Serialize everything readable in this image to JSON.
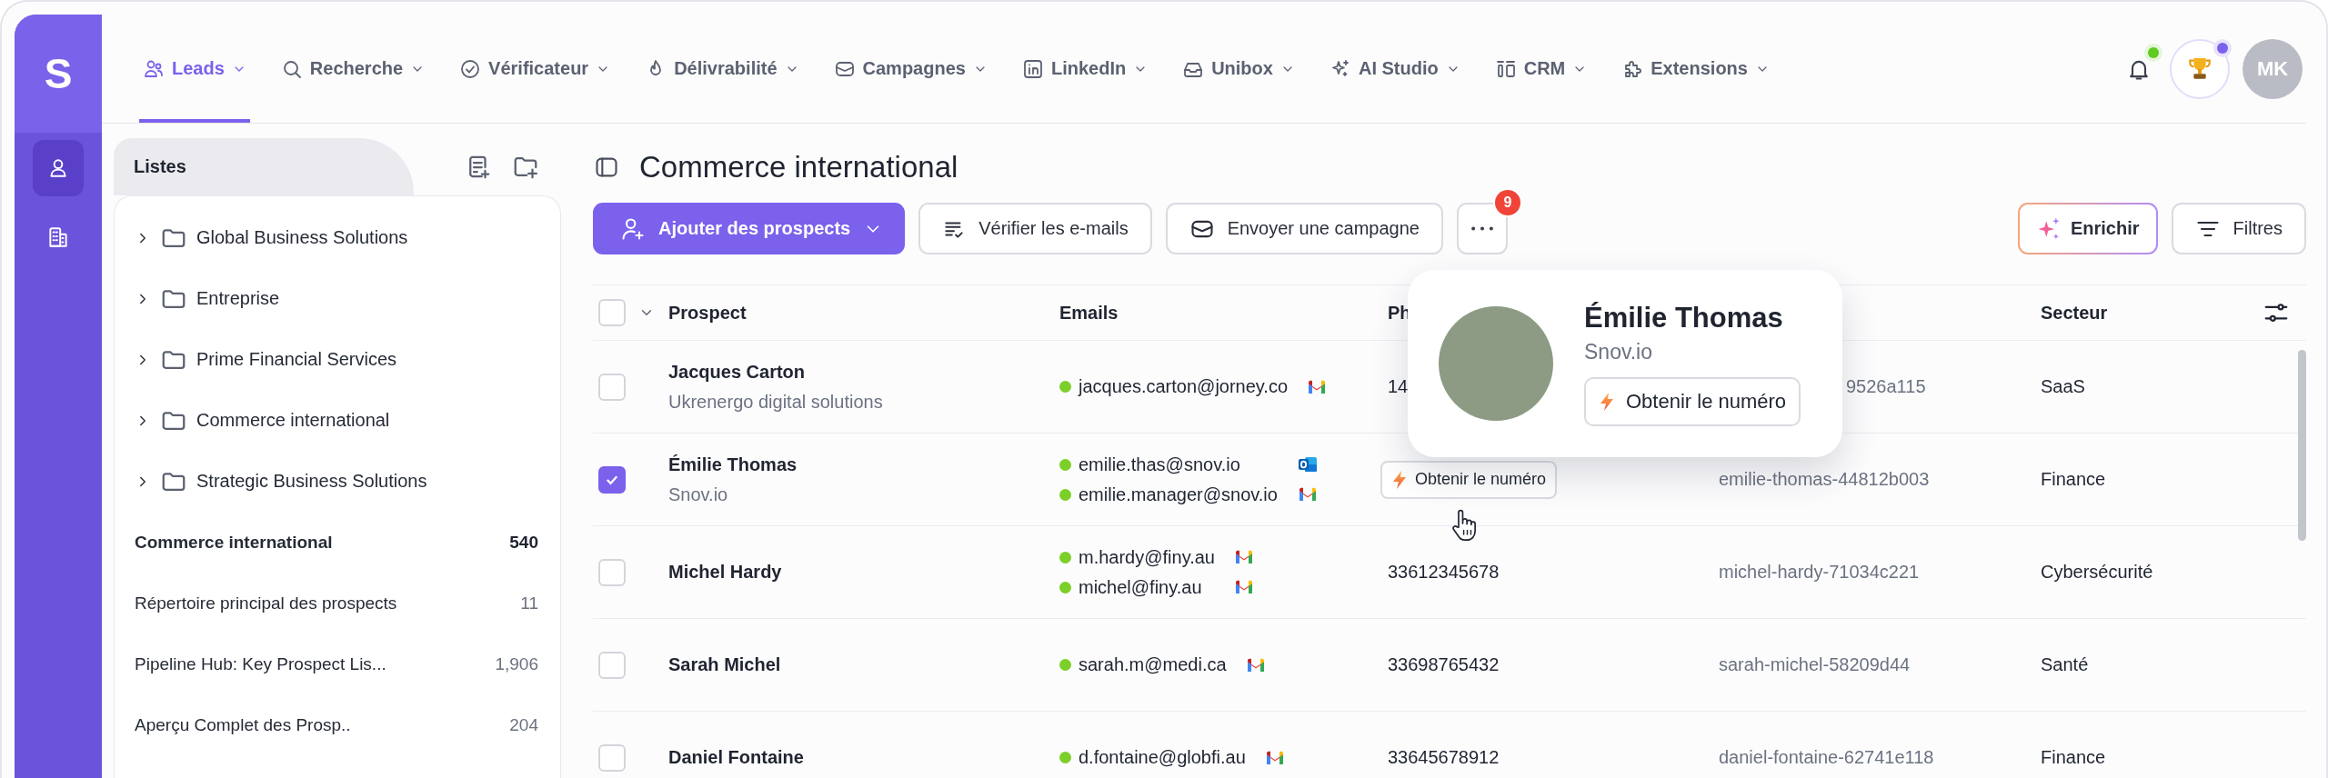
{
  "rail": {
    "logo": "S",
    "items": [
      {
        "selected": true
      },
      {
        "selected": false
      }
    ]
  },
  "nav": {
    "items": [
      {
        "label": "Leads",
        "selected": true
      },
      {
        "label": "Recherche",
        "selected": false
      },
      {
        "label": "Vérificateur",
        "selected": false
      },
      {
        "label": "Délivrabilité",
        "selected": false
      },
      {
        "label": "Campagnes",
        "selected": false
      },
      {
        "label": "LinkedIn",
        "selected": false
      },
      {
        "label": "Unibox",
        "selected": false
      },
      {
        "label": "AI Studio",
        "selected": false
      },
      {
        "label": "CRM",
        "selected": false
      },
      {
        "label": "Extensions",
        "selected": false
      }
    ],
    "notifications": {
      "unread": true
    },
    "rewards": {
      "unread": true
    },
    "avatar": "MK"
  },
  "sidebar": {
    "title": "Listes",
    "folders": [
      {
        "label": "Global Business Solutions",
        "expanded": false
      },
      {
        "label": "Entreprise",
        "expanded": false
      },
      {
        "label": "Prime Financial Services",
        "expanded": false
      },
      {
        "label": "Commerce international",
        "expanded": false
      },
      {
        "label": "Strategic Business Solutions",
        "expanded": false
      }
    ],
    "lists": [
      {
        "label": "Commerce international",
        "count": "540",
        "selected": true
      },
      {
        "label": "Répertoire principal des prospects",
        "count": "11",
        "selected": false
      },
      {
        "label": "Pipeline Hub: Key Prospect Lis...",
        "count": "1,906",
        "selected": false
      },
      {
        "label": "Aperçu Complet des Prosp..",
        "count": "204",
        "selected": false
      }
    ]
  },
  "main": {
    "title": "Commerce international",
    "toolbar": {
      "add": "Ajouter des prospects",
      "verify": "Vérifier les e-mails",
      "campaign": "Envoyer une campagne",
      "more_badge": "9",
      "enrich": "Enrichir",
      "filters": "Filtres"
    },
    "table": {
      "select_all": {
        "checked": false
      },
      "columns": {
        "prospect": "Prospect",
        "emails": "Emails",
        "column_3": "Ph",
        "sector": "Secteur"
      },
      "rows": [
        {
          "name": "Jacques Carton",
          "company": "Ukrenergo digital solutions",
          "selected": false,
          "emails": [
            {
              "address": "jacques.carton@jorney.co",
              "kind": "gmail"
            }
          ],
          "phone": {
            "kind": "text",
            "value": "14"
          },
          "linkedin": "9526a115",
          "sector": "SaaS"
        },
        {
          "name": "Émilie Thomas",
          "company": "Snov.io",
          "selected": true,
          "emails": [
            {
              "address": "emilie.thas@snov.io",
              "kind": "outlook"
            },
            {
              "address": "emilie.manager@snov.io",
              "kind": "gmail"
            }
          ],
          "phone": {
            "kind": "action",
            "label": "Obtenir le numéro",
            "hovered": true
          },
          "linkedin": "emilie-thomas-44812b003",
          "sector": "Finance"
        },
        {
          "name": "Michel Hardy",
          "selected": false,
          "emails": [
            {
              "address": "m.hardy@finy.au",
              "kind": "gmail"
            },
            {
              "address": "michel@finy.au",
              "kind": "gmail"
            }
          ],
          "phone": {
            "kind": "text",
            "value": "33612345678"
          },
          "linkedin": "michel-hardy-71034c221",
          "sector": "Cybersécurité"
        },
        {
          "name": "Sarah Michel",
          "selected": false,
          "emails": [
            {
              "address": "sarah.m@medi.ca",
              "kind": "gmail"
            }
          ],
          "phone": {
            "kind": "text",
            "value": "33698765432"
          },
          "linkedin": "sarah-michel-58209d44",
          "sector": "Santé"
        },
        {
          "name": "Daniel Fontaine",
          "selected": false,
          "emails": [
            {
              "address": "d.fontaine@globfi.au",
              "kind": "gmail"
            }
          ],
          "phone": {
            "kind": "text",
            "value": "33645678912"
          },
          "linkedin": "daniel-fontaine-62741e118",
          "sector": "Finance"
        }
      ]
    },
    "profile_card": {
      "name": "Émilie Thomas",
      "company": "Snov.io",
      "action": "Obtenir le numéro"
    }
  }
}
